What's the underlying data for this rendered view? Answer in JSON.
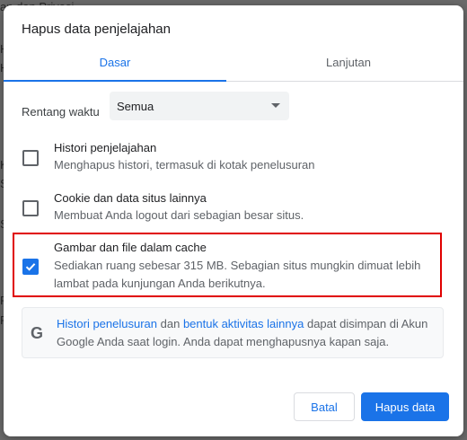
{
  "background": {
    "fragments": [
      "an dan Privasi",
      "H",
      "H",
      "K",
      "S",
      "S",
      "P",
      "F"
    ]
  },
  "dialog": {
    "title": "Hapus data penjelajahan",
    "tabs": [
      {
        "label": "Dasar",
        "active": true
      },
      {
        "label": "Lanjutan",
        "active": false
      }
    ],
    "time_range": {
      "label": "Rentang waktu",
      "value": "Semua"
    },
    "items": [
      {
        "title": "Histori penjelajahan",
        "description": "Menghapus histori, termasuk di kotak penelusuran",
        "checked": false
      },
      {
        "title": "Cookie dan data situs lainnya",
        "description": "Membuat Anda logout dari sebagian besar situs.",
        "checked": false
      },
      {
        "title": "Gambar dan file dalam cache",
        "description": "Sediakan ruang sebesar 315 MB. Sebagian situs mungkin dimuat lebih lambat pada kunjungan Anda berikutnya.",
        "checked": true
      }
    ],
    "info": {
      "icon": "google-g-icon",
      "link1": "Histori penelusuran",
      "text1": " dan ",
      "link2": "bentuk aktivitas lainnya",
      "text2": " dapat disimpan di Akun Google Anda saat login. Anda dapat menghapusnya kapan saja."
    },
    "buttons": {
      "cancel": "Batal",
      "confirm": "Hapus data"
    }
  },
  "colors": {
    "accent": "#1a73e8",
    "highlight": "#e00000"
  }
}
